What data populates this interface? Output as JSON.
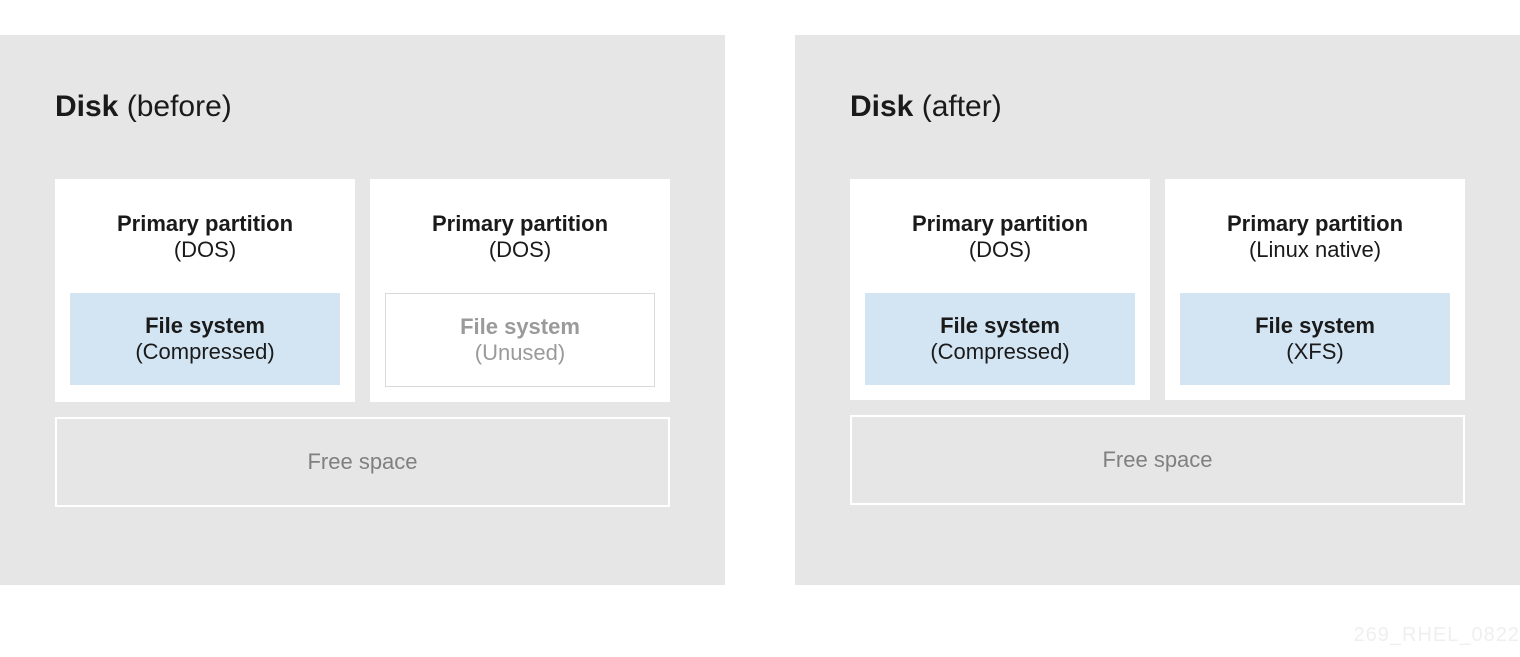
{
  "panels": [
    {
      "title_bold": "Disk",
      "title_rest": " (before)",
      "partitions": [
        {
          "title": "Primary partition",
          "subtitle": "(DOS)",
          "fs_title": "File system",
          "fs_subtitle": "(Compressed)",
          "fs_style": "filled"
        },
        {
          "title": "Primary partition",
          "subtitle": "(DOS)",
          "fs_title": "File system",
          "fs_subtitle": "(Unused)",
          "fs_style": "unused"
        }
      ],
      "free_space": "Free space"
    },
    {
      "title_bold": "Disk",
      "title_rest": " (after)",
      "partitions": [
        {
          "title": "Primary partition",
          "subtitle": "(DOS)",
          "fs_title": "File system",
          "fs_subtitle": "(Compressed)",
          "fs_style": "filled"
        },
        {
          "title": "Primary partition",
          "subtitle": "(Linux native)",
          "fs_title": "File system",
          "fs_subtitle": "(XFS)",
          "fs_style": "filled"
        }
      ],
      "free_space": "Free space"
    }
  ],
  "watermark": "269_RHEL_0822"
}
